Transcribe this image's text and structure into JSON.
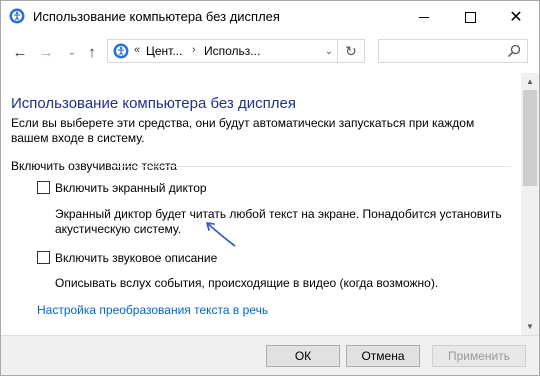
{
  "window": {
    "title": "Использование компьютера без дисплея",
    "icon": "ease-of-access-icon",
    "minimize_icon": "minimize-icon",
    "maximize_icon": "maximize-icon",
    "close_label": "✕"
  },
  "navigation": {
    "back_label": "←",
    "forward_label": "→",
    "recent_label": "⌄",
    "up_label": "↑",
    "breadcrumb_sep_1": "«",
    "breadcrumb_1": "Цент...",
    "breadcrumb_sep_2": "›",
    "breadcrumb_2": "Использ...",
    "dropdown_label": "⌄",
    "refresh_label": "↻",
    "search_placeholder": ""
  },
  "content": {
    "page_title": "Использование компьютера без дисплея",
    "description": "Если вы выберете эти средства, они будут автоматически запускаться при каждом вашем входе в систему.",
    "section_heading": "Включить озвучивание текста",
    "options": [
      {
        "label": "Включить экранный диктор",
        "checked": false,
        "description": "Экранный диктор будет читать любой текст на экране. Понадобится установить акустическую систему."
      },
      {
        "label": "Включить звуковое описание",
        "checked": false,
        "description": "Описывать вслух события, происходящие в видео (когда возможно)."
      }
    ],
    "link": "Настройка преобразования текста в речь"
  },
  "scrollbar": {
    "up_label": "▲",
    "down_label": "▼"
  },
  "buttons": {
    "ok": "ОК",
    "cancel": "Отмена",
    "apply": "Применить"
  },
  "colors": {
    "title_blue": "#1e3287",
    "link_blue": "#0066cc",
    "annotation_arrow": "#3a5fb5"
  }
}
